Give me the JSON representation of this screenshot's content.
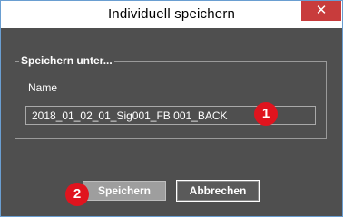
{
  "window": {
    "title": "Individuell speichern",
    "close_glyph": "✕"
  },
  "dialog": {
    "group_title": "Speichern unter...",
    "name_label": "Name",
    "name_value": "2018_01_02_01_Sig001_FB 001_BACK"
  },
  "buttons": {
    "save_label": "Speichern",
    "cancel_label": "Abbrechen"
  },
  "annotations": {
    "marker_1": "1",
    "marker_2": "2"
  },
  "colors": {
    "background": "#4f4f4f",
    "titlebar": "#ffffff",
    "close_button": "#c83c3c",
    "marker": "#e0141e",
    "save_button": "#9e9e9e"
  }
}
